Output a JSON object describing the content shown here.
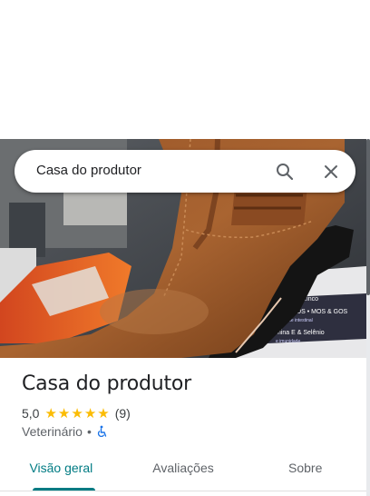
{
  "search": {
    "query": "Casa do produtor"
  },
  "photo": {
    "box_text_lines": [
      "1 & 6 • zinco",
      "IÓTICOS • MOS & GOS",
      "saúde intestinal",
      "mina E & Selênio",
      "e imunidade"
    ]
  },
  "place": {
    "name": "Casa do produtor",
    "rating": "5,0",
    "stars": 5,
    "review_count": "(9)",
    "category": "Veterinário",
    "separator": "•"
  },
  "tabs": [
    {
      "label": "Visão geral",
      "active": true
    },
    {
      "label": "Avaliações",
      "active": false
    },
    {
      "label": "Sobre",
      "active": false
    }
  ],
  "colors": {
    "accent": "#007b83",
    "star": "#fbbc04",
    "accessible_icon": "#1a73e8"
  }
}
